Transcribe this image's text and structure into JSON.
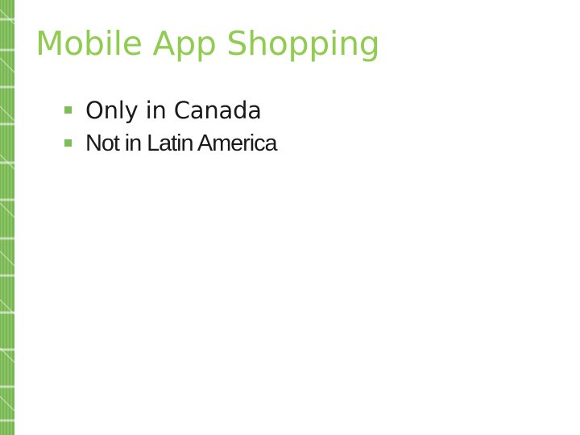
{
  "slide": {
    "title": "Mobile App Shopping",
    "bullets": [
      {
        "text": "Only in Canada"
      },
      {
        "text": "Not in Latin America"
      }
    ]
  },
  "decoration": {
    "left_strip": "green-vertical-pattern-strip"
  },
  "colors": {
    "title": "#8fcc4f",
    "bullet_marker": "#7dbd56",
    "strip_green": "#5fa83a",
    "strip_light": "#9ed16f"
  }
}
